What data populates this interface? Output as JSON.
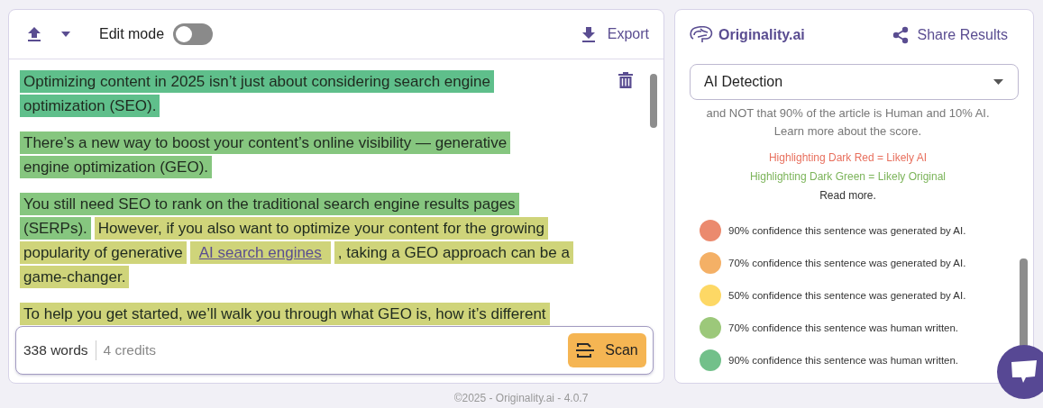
{
  "toolbar": {
    "edit_mode": {
      "label": "Edit mode",
      "on": false
    },
    "export": "Export"
  },
  "paragraphs": [
    {
      "lines": [
        {
          "segments": [
            {
              "kind": "text",
              "text": "Optimizing content in 2025 isn’t just about considering search engine",
              "color": "#5fbf8b"
            }
          ]
        },
        {
          "segments": [
            {
              "kind": "text",
              "text": "optimization (SEO).",
              "color": "#5fbf8b"
            }
          ]
        }
      ]
    },
    {
      "lines": [
        {
          "segments": [
            {
              "kind": "text",
              "text": "There’s a new way to boost your content’s online visibility — generative",
              "color": "#86c67f"
            }
          ]
        },
        {
          "segments": [
            {
              "kind": "text",
              "text": "engine optimization (GEO).",
              "color": "#86c67f"
            }
          ]
        }
      ]
    },
    {
      "lines": [
        {
          "segments": [
            {
              "kind": "text",
              "text": "You still need SEO to rank on the traditional search engine results pages",
              "color": "#86c67f"
            }
          ]
        },
        {
          "segments": [
            {
              "kind": "text",
              "text": "(SERPs).",
              "color": "#86c67f"
            },
            {
              "kind": "text",
              "text": "However, if you also want to optimize your content for the growing",
              "color": "#cfd47a"
            }
          ]
        },
        {
          "segments": [
            {
              "kind": "text",
              "text": "popularity of generative",
              "color": "#cfd47a"
            },
            {
              "kind": "link",
              "text": "AI search engines",
              "color": "#cfd47a"
            },
            {
              "kind": "text",
              "text": ", taking a GEO approach can be a",
              "color": "#cfd47a"
            }
          ]
        },
        {
          "segments": [
            {
              "kind": "text",
              "text": "game-changer.",
              "color": "#cfd47a"
            }
          ]
        }
      ]
    },
    {
      "lines": [
        {
          "segments": [
            {
              "kind": "text",
              "text": "To help you get started, we’ll walk you through what GEO is, how it’s different",
              "color": "#cfd47a"
            }
          ]
        }
      ]
    }
  ],
  "footer_bar": {
    "words": "338 words",
    "credits": "4 credits",
    "scan": "Scan"
  },
  "copyright": "©2025 - Originality.ai - 4.0.7",
  "results": {
    "brand": "Originality.ai",
    "share": "Share Results",
    "dropdown": "AI Detection",
    "notes": [
      {
        "text": "and NOT that 90% of the article is Human and 10% AI.",
        "kind": "plain"
      },
      {
        "text": "Learn more about the score.",
        "kind": "plain"
      },
      {
        "text": "Highlighting Dark Red = Likely AI",
        "kind": "red"
      },
      {
        "text": "Highlighting Dark Green = Likely Original",
        "kind": "green"
      },
      {
        "text": "Read more.",
        "kind": "dark"
      }
    ],
    "legend": [
      {
        "text": "90% confidence this sentence was generated by AI.",
        "color": "#eb8a6e"
      },
      {
        "text": "70% confidence this sentence was generated by AI.",
        "color": "#f4b066"
      },
      {
        "text": "50% confidence this sentence was generated by AI.",
        "color": "#fdd865"
      },
      {
        "text": "70% confidence this sentence was human written.",
        "color": "#9cc87a"
      },
      {
        "text": "90% confidence this sentence was human written.",
        "color": "#72c08a"
      }
    ]
  }
}
